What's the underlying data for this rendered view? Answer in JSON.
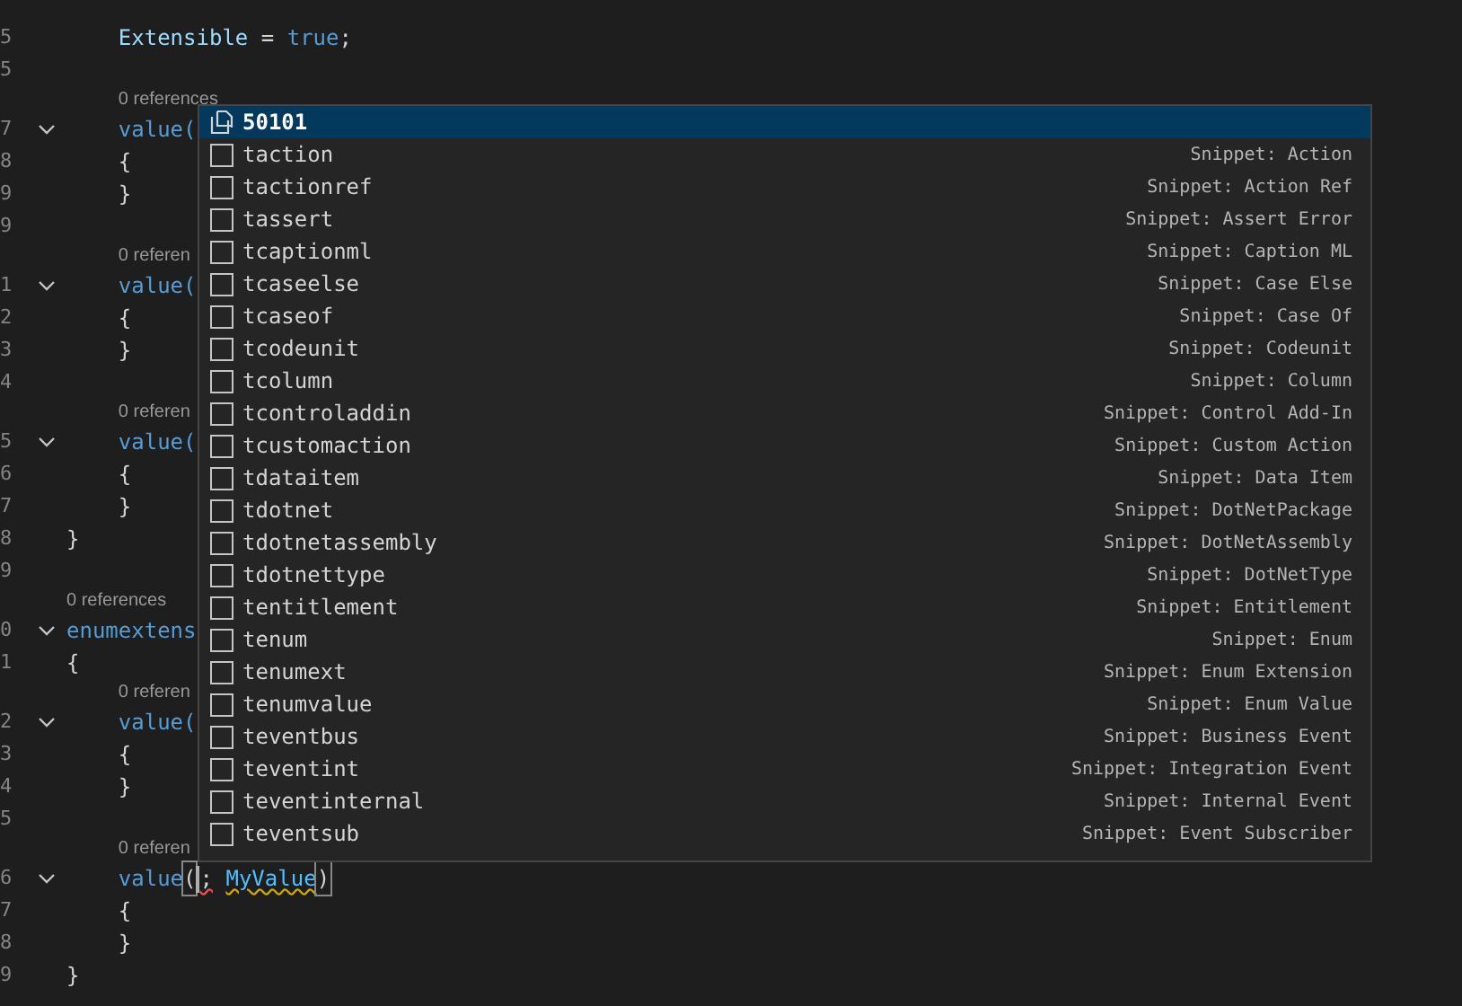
{
  "editor": {
    "lines": [
      {
        "kind": "code",
        "number": "5",
        "fold": false,
        "tokens": [
          {
            "kind": "property",
            "text": "    Extensible"
          },
          {
            "kind": "plain",
            "text": " = "
          },
          {
            "kind": "keyword",
            "text": "true"
          },
          {
            "kind": "plain",
            "text": ";"
          }
        ]
      },
      {
        "kind": "code",
        "number": "5",
        "fold": false
      },
      {
        "kind": "codelens",
        "text": "    0 references"
      },
      {
        "kind": "code",
        "number": "7",
        "fold": true,
        "tokens": [
          {
            "kind": "keyword",
            "text": "    value("
          }
        ]
      },
      {
        "kind": "code",
        "number": "8",
        "fold": false,
        "tokens": [
          {
            "kind": "plain",
            "text": "    {"
          }
        ]
      },
      {
        "kind": "code",
        "number": "9",
        "fold": false,
        "tokens": [
          {
            "kind": "plain",
            "text": "    }"
          }
        ]
      },
      {
        "kind": "code",
        "number": "9",
        "fold": false
      },
      {
        "kind": "codelens",
        "text": "    0 referen"
      },
      {
        "kind": "code",
        "number": "1",
        "fold": true,
        "tokens": [
          {
            "kind": "keyword",
            "text": "    value("
          }
        ]
      },
      {
        "kind": "code",
        "number": "2",
        "fold": false,
        "tokens": [
          {
            "kind": "plain",
            "text": "    {"
          }
        ]
      },
      {
        "kind": "code",
        "number": "3",
        "fold": false,
        "tokens": [
          {
            "kind": "plain",
            "text": "    }"
          }
        ]
      },
      {
        "kind": "code",
        "number": "4",
        "fold": false
      },
      {
        "kind": "codelens",
        "text": "    0 referen"
      },
      {
        "kind": "code",
        "number": "5",
        "fold": true,
        "tokens": [
          {
            "kind": "keyword",
            "text": "    value("
          }
        ]
      },
      {
        "kind": "code",
        "number": "6",
        "fold": false,
        "tokens": [
          {
            "kind": "plain",
            "text": "    {"
          }
        ]
      },
      {
        "kind": "code",
        "number": "7",
        "fold": false,
        "tokens": [
          {
            "kind": "plain",
            "text": "    }"
          }
        ]
      },
      {
        "kind": "code",
        "number": "8",
        "fold": false,
        "tokens": [
          {
            "kind": "plain",
            "text": "}"
          }
        ]
      },
      {
        "kind": "code",
        "number": "9",
        "fold": false
      },
      {
        "kind": "codelens",
        "text": "0 references"
      },
      {
        "kind": "code",
        "number": "0",
        "fold": true,
        "tokens": [
          {
            "kind": "keyword",
            "text": "enumextens"
          }
        ]
      },
      {
        "kind": "code",
        "number": "1",
        "fold": false,
        "tokens": [
          {
            "kind": "plain",
            "text": "{"
          }
        ]
      },
      {
        "kind": "codelens",
        "text": "    0 referen"
      },
      {
        "kind": "code",
        "number": "2",
        "fold": true,
        "tokens": [
          {
            "kind": "keyword",
            "text": "    value("
          }
        ]
      },
      {
        "kind": "code",
        "number": "3",
        "fold": false,
        "tokens": [
          {
            "kind": "plain",
            "text": "    {"
          }
        ]
      },
      {
        "kind": "code",
        "number": "4",
        "fold": false,
        "tokens": [
          {
            "kind": "plain",
            "text": "    }"
          }
        ]
      },
      {
        "kind": "code",
        "number": "5",
        "fold": false
      },
      {
        "kind": "codelens",
        "text": "    0 referen"
      },
      {
        "kind": "code",
        "number": "6",
        "fold": true,
        "tokens": [
          {
            "kind": "keyword",
            "text": "    value"
          },
          {
            "kind": "bracket",
            "text": "("
          },
          {
            "kind": "error",
            "text": ";",
            "cursor_before": true
          },
          {
            "kind": "warning",
            "text": " MyValue"
          },
          {
            "kind": "bracket",
            "text": ")"
          }
        ]
      },
      {
        "kind": "code",
        "number": "7",
        "fold": false,
        "tokens": [
          {
            "kind": "plain",
            "text": "    {"
          }
        ]
      },
      {
        "kind": "code",
        "number": "8",
        "fold": false,
        "tokens": [
          {
            "kind": "plain",
            "text": "    }"
          }
        ]
      },
      {
        "kind": "code",
        "number": "9",
        "fold": false,
        "tokens": [
          {
            "kind": "plain",
            "text": "}"
          }
        ]
      }
    ]
  },
  "suggestions": [
    {
      "kind": "reference",
      "label": "50101",
      "selected": true
    },
    {
      "kind": "snippet",
      "label": "taction",
      "detail": "Snippet: Action",
      "selected": false
    },
    {
      "kind": "snippet",
      "label": "tactionref",
      "detail": "Snippet: Action Ref",
      "selected": false
    },
    {
      "kind": "snippet",
      "label": "tassert",
      "detail": "Snippet: Assert Error",
      "selected": false
    },
    {
      "kind": "snippet",
      "label": "tcaptionml",
      "detail": "Snippet: Caption ML",
      "selected": false
    },
    {
      "kind": "snippet",
      "label": "tcaseelse",
      "detail": "Snippet: Case Else",
      "selected": false
    },
    {
      "kind": "snippet",
      "label": "tcaseof",
      "detail": "Snippet: Case Of",
      "selected": false
    },
    {
      "kind": "snippet",
      "label": "tcodeunit",
      "detail": "Snippet: Codeunit",
      "selected": false
    },
    {
      "kind": "snippet",
      "label": "tcolumn",
      "detail": "Snippet: Column",
      "selected": false
    },
    {
      "kind": "snippet",
      "label": "tcontroladdin",
      "detail": "Snippet: Control Add-In",
      "selected": false
    },
    {
      "kind": "snippet",
      "label": "tcustomaction",
      "detail": "Snippet: Custom Action",
      "selected": false
    },
    {
      "kind": "snippet",
      "label": "tdataitem",
      "detail": "Snippet: Data Item",
      "selected": false
    },
    {
      "kind": "snippet",
      "label": "tdotnet",
      "detail": "Snippet: DotNetPackage",
      "selected": false
    },
    {
      "kind": "snippet",
      "label": "tdotnetassembly",
      "detail": "Snippet: DotNetAssembly",
      "selected": false
    },
    {
      "kind": "snippet",
      "label": "tdotnettype",
      "detail": "Snippet: DotNetType",
      "selected": false
    },
    {
      "kind": "snippet",
      "label": "tentitlement",
      "detail": "Snippet: Entitlement",
      "selected": false
    },
    {
      "kind": "snippet",
      "label": "tenum",
      "detail": "Snippet: Enum",
      "selected": false
    },
    {
      "kind": "snippet",
      "label": "tenumext",
      "detail": "Snippet: Enum Extension",
      "selected": false
    },
    {
      "kind": "snippet",
      "label": "tenumvalue",
      "detail": "Snippet: Enum Value",
      "selected": false
    },
    {
      "kind": "snippet",
      "label": "teventbus",
      "detail": "Snippet: Business Event",
      "selected": false
    },
    {
      "kind": "snippet",
      "label": "teventint",
      "detail": "Snippet: Integration Event",
      "selected": false
    },
    {
      "kind": "snippet",
      "label": "teventinternal",
      "detail": "Snippet: Internal Event",
      "selected": false
    },
    {
      "kind": "snippet",
      "label": "teventsub",
      "detail": "Snippet: Event Subscriber",
      "selected": false
    }
  ]
}
